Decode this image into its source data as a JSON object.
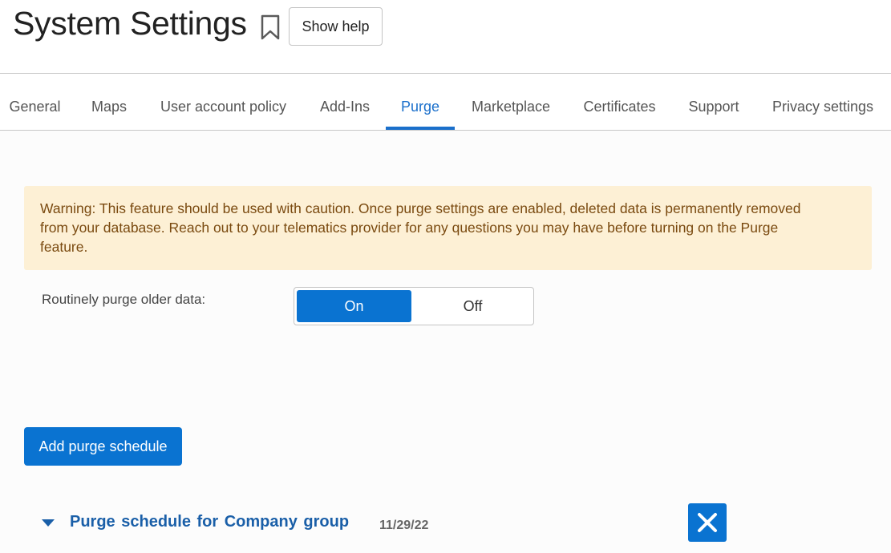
{
  "header": {
    "title": "System Settings",
    "bookmark_icon": "bookmark-icon",
    "help_label": "Show help"
  },
  "tabs": [
    {
      "label": "General",
      "active": false
    },
    {
      "label": "Maps",
      "active": false
    },
    {
      "label": "User account policy",
      "active": false
    },
    {
      "label": "Add-Ins",
      "active": false
    },
    {
      "label": "Purge",
      "active": true
    },
    {
      "label": "Marketplace",
      "active": false
    },
    {
      "label": "Certificates",
      "active": false
    },
    {
      "label": "Support",
      "active": false
    },
    {
      "label": "Privacy settings",
      "active": false
    }
  ],
  "warning": {
    "text": "Warning: This feature should be used with caution. Once purge settings are enabled, deleted data is permanently removed from your database. Reach out to your telematics provider for any questions you may have before turning on the Purge feature."
  },
  "purge_setting": {
    "label": "Routinely purge older data:",
    "on_label": "On",
    "off_label": "Off",
    "selected": "On"
  },
  "add_schedule": {
    "label": "Add purge schedule"
  },
  "schedule": {
    "title": "Purge schedule for Company group",
    "date": "11/29/22",
    "caret_icon": "caret-down-icon",
    "delete_icon": "close-icon"
  },
  "colors": {
    "accent": "#0a73d1",
    "link": "#1a5fa8",
    "warning_bg": "#fdf0d5",
    "warning_text": "#7a4a10"
  }
}
